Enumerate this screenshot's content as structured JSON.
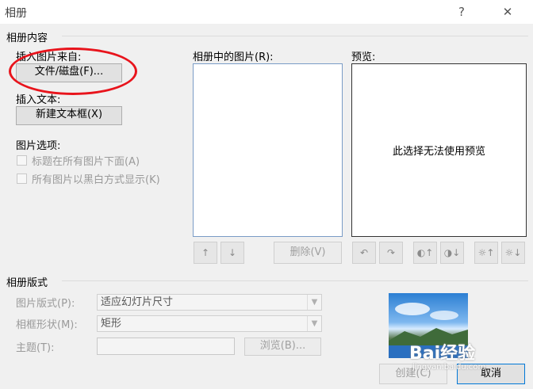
{
  "window": {
    "title": "相册",
    "help": "?",
    "close": "✕"
  },
  "content_group": {
    "label": "相册内容"
  },
  "insert_picture": {
    "label": "插入图片来自:",
    "button": "文件/磁盘(F)..."
  },
  "insert_text": {
    "label": "插入文本:",
    "button": "新建文本框(X)"
  },
  "picture_options": {
    "label": "图片选项:",
    "caption_below": "标题在所有图片下面(A)",
    "black_white": "所有图片以黑白方式显示(K)"
  },
  "pictures_in_album": {
    "label": "相册中的图片(R):",
    "up": "↑",
    "down": "↓",
    "remove": "删除(V)"
  },
  "preview": {
    "label": "预览:",
    "message": "此选择无法使用预览",
    "rotate_left": "↶",
    "rotate_right": "↷",
    "contrast_up": "◐↑",
    "contrast_down": "◑↓",
    "bright_up": "☼↑",
    "bright_down": "☼↓"
  },
  "layout_group": {
    "label": "相册版式",
    "picture_layout_label": "图片版式(P):",
    "picture_layout_value": "适应幻灯片尺寸",
    "frame_shape_label": "相框形状(M):",
    "frame_shape_value": "矩形",
    "theme_label": "主题(T):",
    "theme_value": "",
    "browse": "浏览(B)..."
  },
  "footer": {
    "create": "创建(C)",
    "cancel": "取消"
  },
  "watermark": {
    "brand": "Bai经验",
    "url": "jingyan.baidu.com"
  },
  "colors": {
    "annotation": "#e8141c",
    "listbox_border": "#7a9cc6"
  }
}
